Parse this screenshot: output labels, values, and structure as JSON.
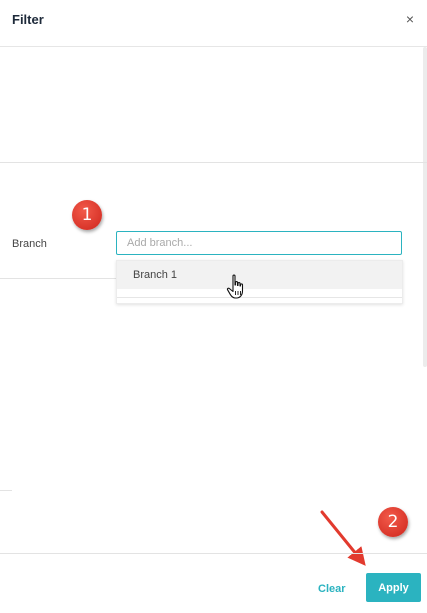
{
  "dialog": {
    "title": "Filter",
    "close_glyph": "×",
    "close_icon": "close-icon"
  },
  "branch_field": {
    "label": "Branch",
    "placeholder": "Add branch...",
    "value": "",
    "options": [
      "Branch 1"
    ]
  },
  "annotations": {
    "step1": "1",
    "step2": "2",
    "badge_color": "#d9352a"
  },
  "footer": {
    "clear_label": "Clear",
    "apply_label": "Apply"
  },
  "colors": {
    "accent": "#2bb3c0",
    "title": "#1e2a3a"
  }
}
